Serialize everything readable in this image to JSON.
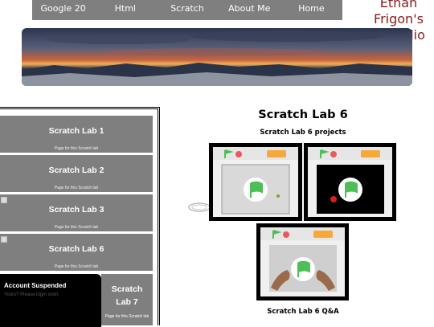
{
  "nav": {
    "items": [
      "Google 20",
      "Html",
      "Scratch",
      "About Me",
      "Home"
    ]
  },
  "site_title": [
    "Ethan",
    "Frigon's",
    "Portfolio"
  ],
  "sidebar": {
    "labs": [
      {
        "title": "Scratch Lab 1",
        "caption": "Page for this Scratch lab"
      },
      {
        "title": "Scratch Lab 2",
        "caption": "Page for this Scratch lab"
      },
      {
        "title": "Scratch Lab 3",
        "caption": "Page for this Scratch lab"
      },
      {
        "title": "Scratch Lab 6",
        "caption": "Page for this Scratch lab"
      }
    ],
    "lab7": {
      "title_line1": "Scratch",
      "title_line2": "Lab 7",
      "caption": "Page for this Scratch lab"
    },
    "suspended": {
      "heading": "Account Suspended",
      "text": "Yours? Please login soon."
    }
  },
  "main": {
    "title": "Scratch Lab 6",
    "subtitle": "Scratch Lab 6 projects",
    "qa_label": "Scratch Lab 6 Q&A"
  },
  "colors": {
    "nav_bg": "#7f7f7f",
    "title_red": "#8b1a1a",
    "scratch_orange": "#f7a83a",
    "flag_green": "#4cbf56"
  }
}
